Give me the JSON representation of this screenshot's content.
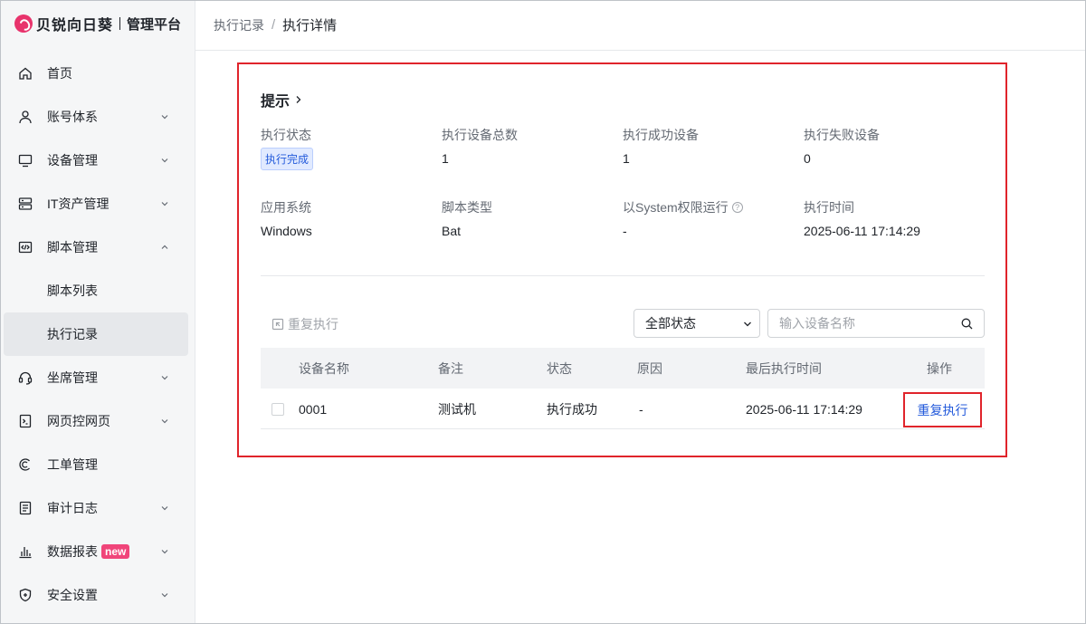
{
  "app": {
    "brand": "贝锐向日葵",
    "subtitle": "管理平台",
    "accent_color": "#e8336c"
  },
  "sidebar": {
    "items": [
      {
        "label": "首页",
        "icon": "home-icon",
        "expandable": false
      },
      {
        "label": "账号体系",
        "icon": "user-icon",
        "expandable": true
      },
      {
        "label": "设备管理",
        "icon": "monitor-icon",
        "expandable": true
      },
      {
        "label": "IT资产管理",
        "icon": "server-icon",
        "expandable": true
      },
      {
        "label": "脚本管理",
        "icon": "code-icon",
        "expandable": true,
        "expanded": true
      },
      {
        "label": "脚本列表",
        "sub": true
      },
      {
        "label": "执行记录",
        "sub": true,
        "active": true
      },
      {
        "label": "坐席管理",
        "icon": "headset-icon",
        "expandable": true
      },
      {
        "label": "网页控网页",
        "icon": "web-terminal-icon",
        "expandable": true
      },
      {
        "label": "工单管理",
        "icon": "ticket-icon",
        "expandable": false
      },
      {
        "label": "审计日志",
        "icon": "audit-log-icon",
        "expandable": true
      },
      {
        "label": "数据报表",
        "icon": "bar-chart-icon",
        "expandable": true,
        "badge": "new"
      },
      {
        "label": "安全设置",
        "icon": "shield-icon",
        "expandable": true
      }
    ]
  },
  "header": {
    "breadcrumb_parent": "执行记录",
    "breadcrumb_separator": "/",
    "breadcrumb_current": "执行详情"
  },
  "detail": {
    "title": "提示",
    "fields": [
      {
        "label": "执行状态",
        "value": "执行完成",
        "is_tag": true
      },
      {
        "label": "执行设备总数",
        "value": "1"
      },
      {
        "label": "执行成功设备",
        "value": "1"
      },
      {
        "label": "执行失败设备",
        "value": "0"
      },
      {
        "label": "应用系统",
        "value": "Windows"
      },
      {
        "label": "脚本类型",
        "value": "Bat"
      },
      {
        "label": "以System权限运行",
        "value": "-",
        "help": "?"
      },
      {
        "label": "执行时间",
        "value": "2025-06-11 17:14:29"
      }
    ]
  },
  "toolbar": {
    "rerun_label": "重复执行",
    "status_filter": "全部状态",
    "search_placeholder": "输入设备名称"
  },
  "table": {
    "columns": [
      "设备名称",
      "备注",
      "状态",
      "原因",
      "最后执行时间",
      "操作"
    ],
    "rows": [
      {
        "device": "0001",
        "note": "测试机",
        "status": "执行成功",
        "reason": "-",
        "last_time": "2025-06-11 17:14:29",
        "action": "重复执行"
      }
    ]
  }
}
